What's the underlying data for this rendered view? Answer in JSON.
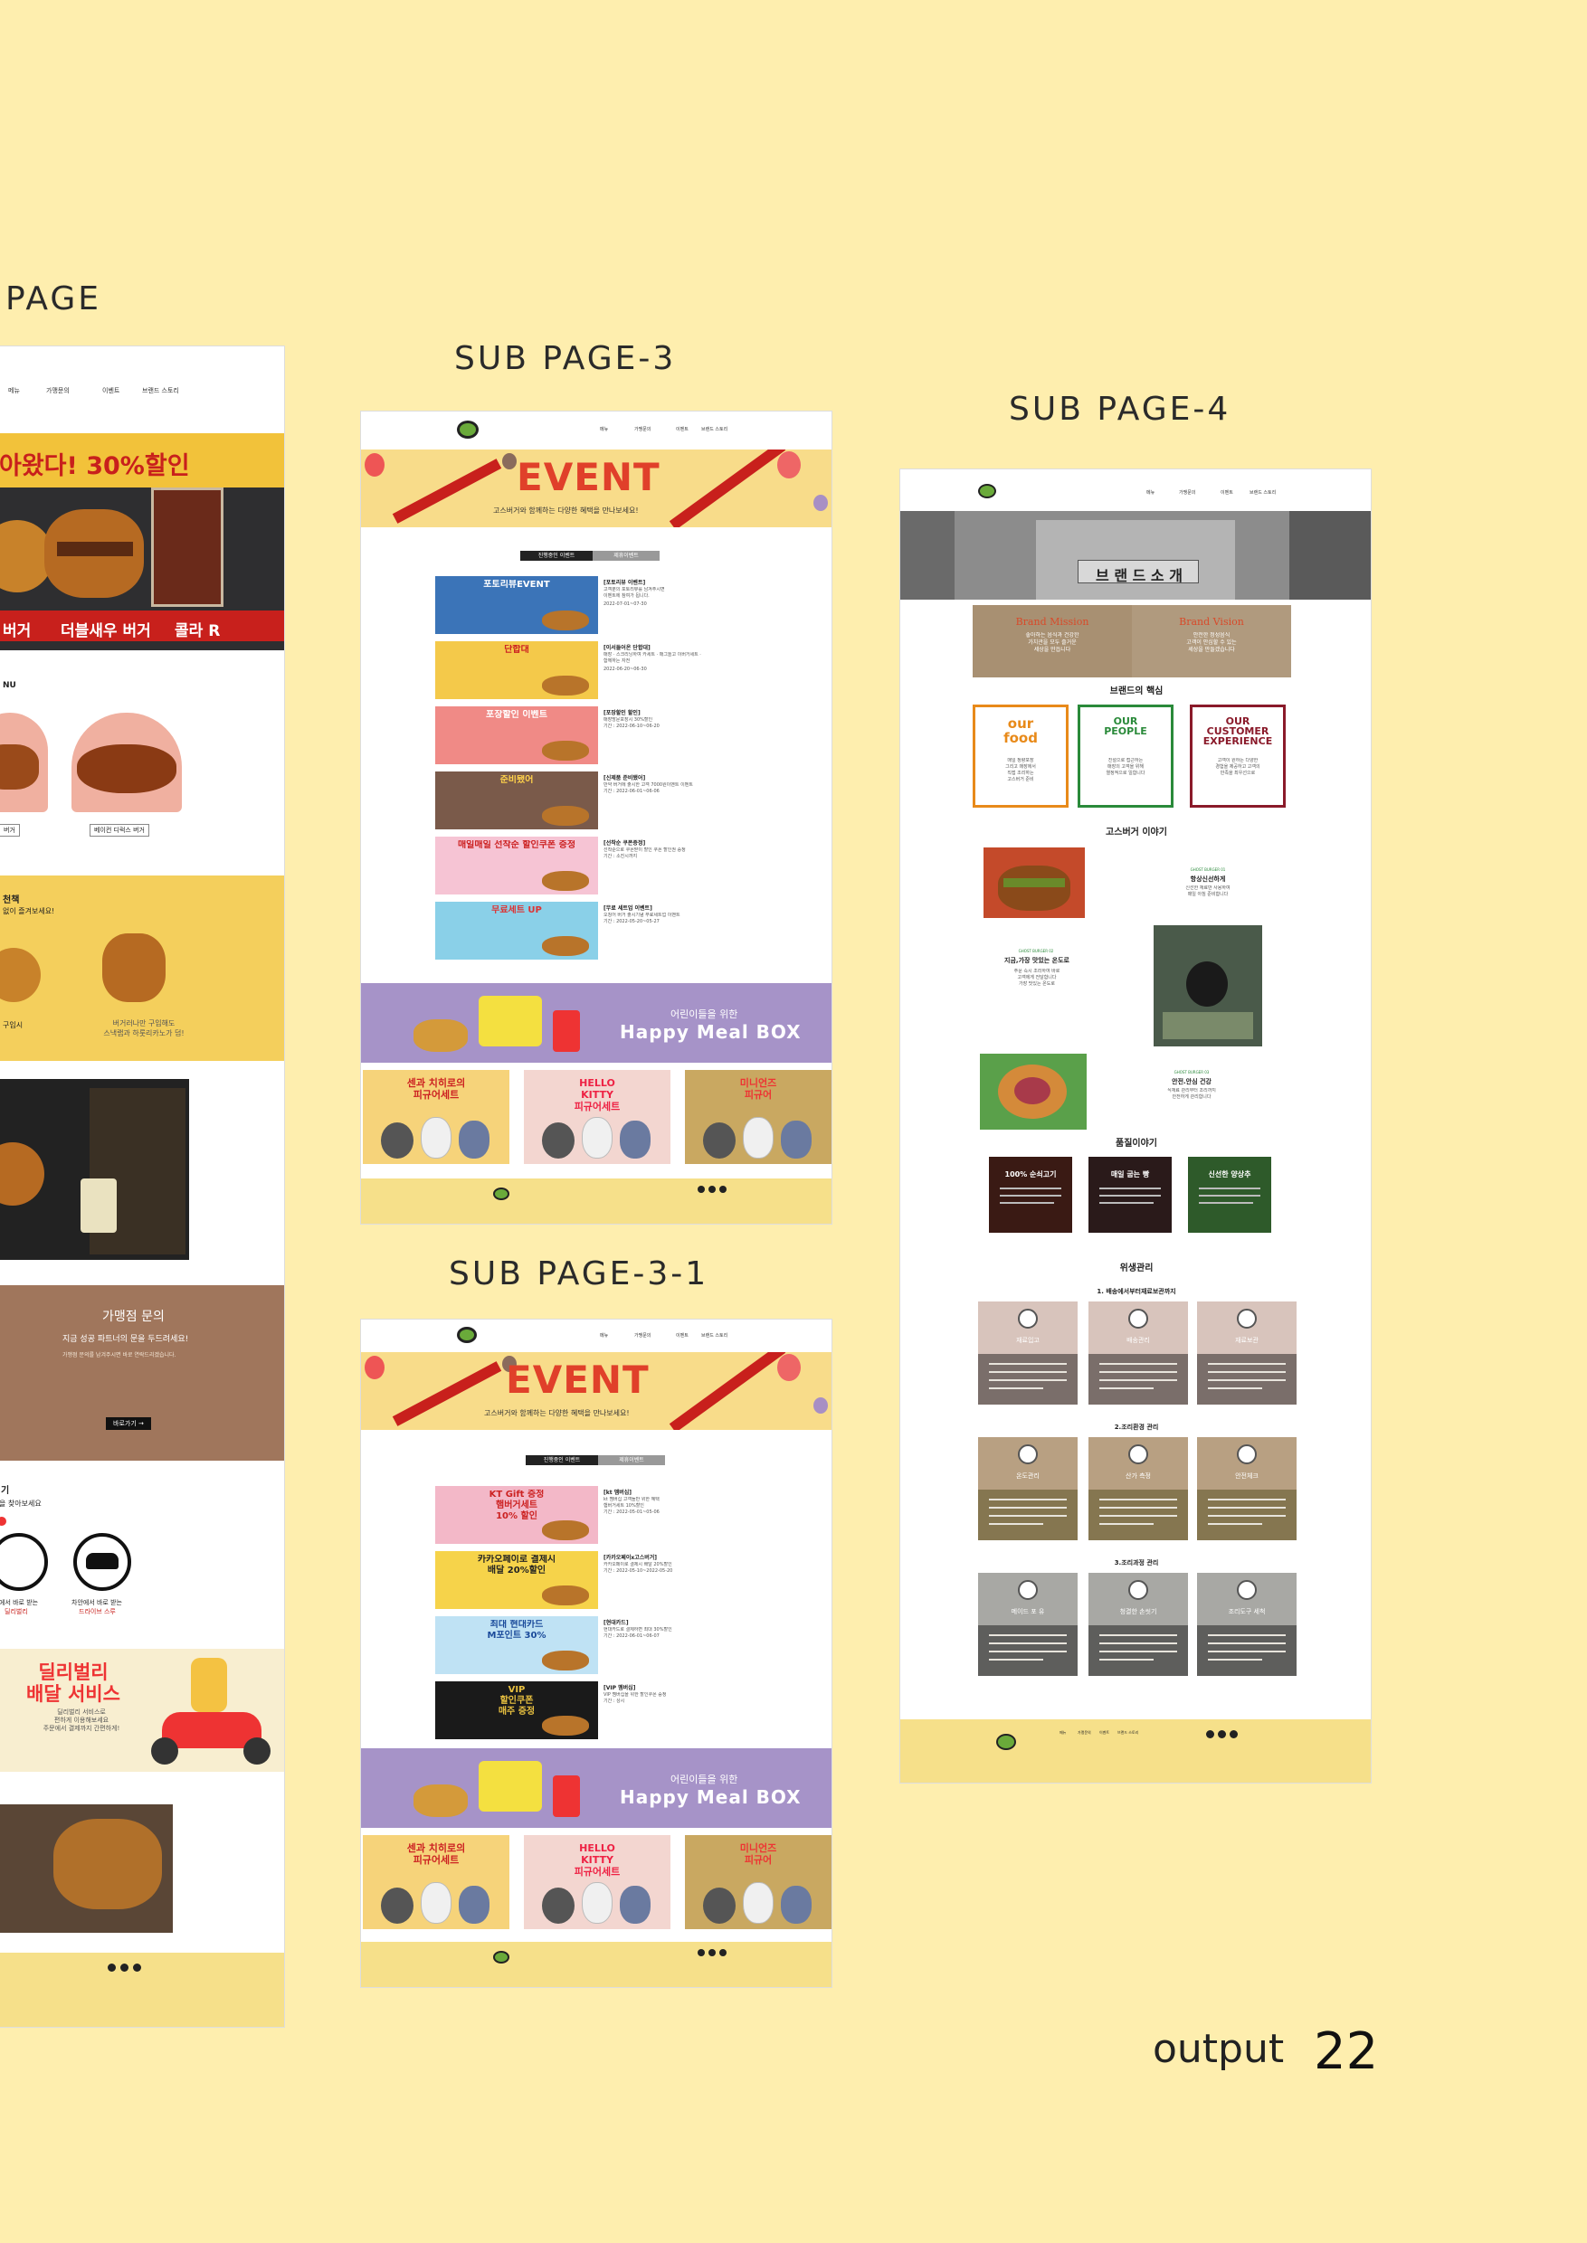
{
  "labels": {
    "page_left": "PAGE",
    "page3": "SUB  PAGE-3",
    "page3_1": "SUB  PAGE-3-1",
    "page4": "SUB  PAGE-4",
    "output": "output",
    "page_number": "22"
  },
  "left_page": {
    "nav": [
      "메뉴",
      "가맹문의",
      "이벤트",
      "브랜드 스토리"
    ],
    "banner_text": "아왔다! 30%할인",
    "banner_items": [
      "버거",
      "더블새우 버거",
      "콜라 R"
    ],
    "menu_heading": "NU",
    "menu_labels": [
      "버거",
      "베이컨 디럭스 버거"
    ],
    "section_title": "천책",
    "section_sub": "없이 즐겨보세요!",
    "section_cap1": "구입시",
    "section_cap2": "버거러나만 구입해도\n스낵랩과 하룻리카노가 덤!",
    "franchise_title": "가맹점 문의",
    "franchise_sub": "지금 성공 파트너의 문을 두드려세요!",
    "franchise_body": "가맹점 문의를 남겨주시면 바로 연락드리겠습니다.",
    "franchise_btn": "바로가기 →",
    "order_title": "기",
    "order_sub": "을 찾아보세요",
    "order_cap1": "에서 바로 받는",
    "order_cap1b": "딜리벌리",
    "order_cap2": "차안에서 바로 받는",
    "order_cap2b": "드라이브 스루",
    "delivery_title": "딜리벌리\n배달 서비스",
    "delivery_sub": "딜리벌리 서비스로\n편하게 이용해보세요\n주문에서 결제까지 간편하게!"
  },
  "page3": {
    "nav": [
      "메뉴",
      "가맹문의",
      "이벤트",
      "브랜드 스토리"
    ],
    "event_title": "EVENT",
    "event_sub": "고스버거와 함께하는 다양한 혜택을 만나보세요!",
    "tab_active": "진행중인 이벤트",
    "tab_inactive": "제휴이벤트",
    "events": [
      {
        "thumb": "포토리뷰EVENT",
        "title": "[포토리뷰 이벤트]",
        "body": "고객분의 포토리뷰를 남겨주시면\n이벤트에 참여가 됩니다.",
        "date": "2022-07-01~07-30",
        "bg": "#3b74b8",
        "fg": "#fff"
      },
      {
        "thumb": "단합대",
        "title": "[이서들어온 단합대]",
        "body": "매장 · 스크리닝하여 카세트 · 매그놀고 이버거세트 ·\n함께하는 자전",
        "date": "2022-06-20~06-30",
        "bg": "#f4c94a",
        "fg": "#c22"
      },
      {
        "thumb": "포장할인 이벤트",
        "title": "[포장할인 할인]",
        "body": "매장방문포장시 30%할인\n기간 : 2022-06-10~06-20",
        "date": "",
        "bg": "#f08a86",
        "fg": "#fff"
      },
      {
        "thumb": "준비됐어",
        "title": "[신제품 준비됐어]",
        "body": "만약 버거에 출시한 고객 7000원이벤트 이벤트\n기간 : 2022-06-01~06-06",
        "date": "",
        "bg": "#7a5a4a",
        "fg": "#ffd24a"
      },
      {
        "thumb": "매일매일 선착순 할인쿠폰 증정",
        "title": "[선착순 쿠폰증정]",
        "body": "선착순으로 쿠폰받이 할인 쿠폰 할인권 증정\n기간 : 소진시까지",
        "date": "",
        "bg": "#f6c4d4",
        "fg": "#c22"
      },
      {
        "thumb": "무료세트 UP",
        "title": "[무료 세트업 이벤트]",
        "body": "오징어 버거 출시기념 무료세트업 이벤트\n기간 : 2022-05-20~05-27",
        "date": "",
        "bg": "#8ad0e8",
        "fg": "#d33"
      }
    ],
    "happy_sub": "어린이들을 위한",
    "happy_title": "Happy Meal BOX",
    "collabs": [
      {
        "title": "센과 치히로의\n피규어세트",
        "bg": "#f6d37a",
        "fg": "#c22"
      },
      {
        "title": "HELLO\nKITTY\n피규어세트",
        "bg": "#f3d6d0",
        "fg": "#e24"
      },
      {
        "title": "미니언즈\n피규어",
        "bg": "#c9a861",
        "fg": "#e33"
      }
    ]
  },
  "page3_1": {
    "nav": [
      "메뉴",
      "가맹문의",
      "이벤트",
      "브랜드 스토리"
    ],
    "event_title": "EVENT",
    "event_sub": "고스버거와 함께하는 다양한 혜택을 만나보세요!",
    "tab_active": "진행중인 이벤트",
    "tab_inactive": "제휴이벤트",
    "events": [
      {
        "thumb": "KT Gift 증정\n햄버거세트\n10% 할인",
        "title": "[kt 멤버십]",
        "body": "kt 멤버십 고객들만 위한 혜택\n햄버거세트 10%할인\n기간 : 2022-05-01~05-06",
        "bg": "#f3b8c8",
        "fg": "#c22"
      },
      {
        "thumb": "카카오페이로 결제시\n배달 20%할인",
        "title": "[카카오페이x고스버거]",
        "body": "카카오페이로 결제시 배달 20%할인\n기간 : 2022-05-10~2022-05-20",
        "bg": "#f6d34a",
        "fg": "#222"
      },
      {
        "thumb": "최대 현대카드\nM포인트 30%",
        "title": "[현대카드]",
        "body": "현대카드로 결제하면 최대 30%할인\n기간 : 2022-06-01~06-07",
        "bg": "#bfe2f4",
        "fg": "#1a4a9a"
      },
      {
        "thumb": "VIP\n할인쿠폰\n매주 증정",
        "title": "[VIP 멤버십]",
        "body": "VIP 멤버십을 위한 할인쿠폰 증정\n기간 : 상시",
        "bg": "#1a1a1a",
        "fg": "#e8c040"
      }
    ],
    "happy_sub": "어린이들을 위한",
    "happy_title": "Happy Meal BOX",
    "collabs": [
      {
        "title": "센과 치히로의\n피규어세트",
        "bg": "#f6d37a",
        "fg": "#c22"
      },
      {
        "title": "HELLO\nKITTY\n피규어세트",
        "bg": "#f3d6d0",
        "fg": "#e24"
      },
      {
        "title": "미니언즈\n피규어",
        "bg": "#c9a861",
        "fg": "#e33"
      }
    ]
  },
  "page4": {
    "nav": [
      "메뉴",
      "가맹문의",
      "이벤트",
      "브랜드 스토리"
    ],
    "hero_title": "브 랜 드  소 개",
    "mission_title": "Brand Mission",
    "mission_body": "좋아하는 음식과 건강한\n가치관을 모두 즐거운\n세상을 만듭니다",
    "vision_title": "Brand Vision",
    "vision_body": "안전한 정성음식\n고객이 안심할 수 있는\n세상을 만들겠습니다",
    "core_heading": "브랜드의 핵심",
    "cores": [
      {
        "title": "our\nfood",
        "body": "매일 정량포장\n그리고 매장에서\n직접 조리하는\n고스버거 준비",
        "color": "#e88a1a"
      },
      {
        "title": "OUR\nPEOPLE",
        "body": "친절으로 접근하는\n매장의 고객을 위해\n열정적으로 일합니다",
        "color": "#2a8a3a"
      },
      {
        "title": "OUR\nCUSTOMER\nEXPERIENCE",
        "body": "고객이 원하는 다양한\n경험을 제공하고 고객의\n만족을 최우선으로",
        "color": "#8a1a2a"
      }
    ],
    "story_heading": "고스버거 이야기",
    "stories": [
      {
        "tag": "GHOST BURGER 01",
        "title": "항상신선하게",
        "body": "신선한 재료만 사용하여\n매일 아침 준비합니다"
      },
      {
        "tag": "GHOST BURGER 02",
        "title": "지금,가장 맛있는 온도로",
        "body": "주문 즉시 조리하여 바로\n고객에게 전달합니다\n가장 맛있는 온도로"
      },
      {
        "tag": "GHOST BURGER 03",
        "title": "안전.안심 건강",
        "body": "식재료 관리부터 조리까지\n안전하게 관리합니다"
      }
    ],
    "quality_heading": "품질이야기",
    "qualities": [
      "100% 순쇠고기",
      "매일 굽는 빵",
      "신선한 양상추"
    ],
    "hygiene_heading": "위생관리",
    "hygiene_groups": [
      {
        "title": "1. 배송에서부터재료보관까지",
        "items": [
          "재료입고",
          "배송관리",
          "재료보관"
        ],
        "top": "#d8c4bc",
        "bottom": "#7a6e6a"
      },
      {
        "title": "2.조리환경 관리",
        "items": [
          "온도관리",
          "산가 측정",
          "안전체크"
        ],
        "top": "#b8a082",
        "bottom": "#857650"
      },
      {
        "title": "3.조리과정 관리",
        "items": [
          "메이드 포 유",
          "청결한 손씻기",
          "조리도구 세척"
        ],
        "top": "#a8a8a4",
        "bottom": "#5e5e5c"
      }
    ],
    "footer_nav": [
      "메뉴",
      "가맹문의",
      "이벤트",
      "브랜드 스토리"
    ]
  },
  "colors": {
    "background": "#feeeae",
    "footer": "#f6e08a",
    "happy_meal": "#a693c8",
    "event_banner": "#f8dc8a",
    "brand_red": "#c8201c"
  }
}
